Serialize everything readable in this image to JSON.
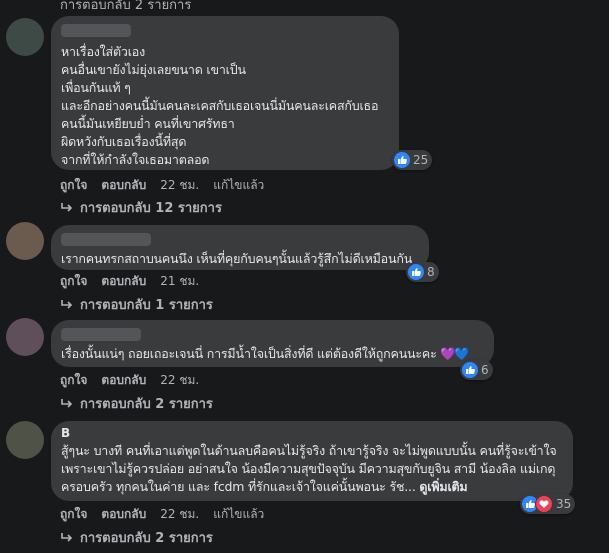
{
  "top_replies": "การตอบกลับ 2 รายการ",
  "comments": [
    {
      "author": "",
      "text": "หาเรื่องใส่ตัวเอง\nคนอื่นเขายังไม่ยุ่งเลยขนาด เขาเป็น\nเพื่อนกันแท้ ๆ\nและอีกอย่างคนนี้มันคนละเคสกับเธอเจนนี่มันคนละเคสกับเธอ\nคนนี้มันเหยียบย่ำ คนที่เขาศรัทธา\nผิดหวังกับเธอเรื่องนี้ที่สุด\nจากที่ให้กำลังใจเธอมาตลอด",
      "reaction_count": "25",
      "like": "ถูกใจ",
      "reply": "ตอบกลับ",
      "time": "22 ชม.",
      "edited": "แก้ไขแล้ว",
      "replies": "การตอบกลับ 12 รายการ"
    },
    {
      "author": "",
      "text": "เรากคนทรกสถาบนคนนึง เห็นที่คุยกับคนๆนั้นแล้วรู้สึกไม่ดีเหมือนกัน",
      "reaction_count": "8",
      "like": "ถูกใจ",
      "reply": "ตอบกลับ",
      "time": "21 ชม.",
      "replies": "การตอบกลับ 1 รายการ"
    },
    {
      "author": "",
      "text": "เรื่องนั้นแน่ๆ ถอยเถอะเจนนี่ การมีน้ำใจเป็นสิ่งที่ดี แต่ต้องดีให้ถูกคนนะคะ ",
      "emoji": "💜💙",
      "reaction_count": "6",
      "like": "ถูกใจ",
      "reply": "ตอบกลับ",
      "time": "22 ชม.",
      "replies": "การตอบกลับ 2 รายการ"
    },
    {
      "author": "B",
      "text": "สู้ๆนะ บางที คนที่เอาแต่พูดในด้านลบคือคนไม่รู้จริง ถ้าเขารู้จริง จะไม่พูดแบบนั้น คนที่รู้จะเข้าใจ เพราะเขาไม่รู้ควรปล่อย อย่าสนใจ น้องมีความสุขปัจจุบัน มีความสุขกับยูจิน สามี น้องลิล แม่เกดุ ครอบครัว ทุกคนในค่าย และ fcdm ที่รักและเจ้าใจแค่นั้นพอนะ รัช... ",
      "see_more": "ดูเพิ่มเติม",
      "reaction_count": "35",
      "like": "ถูกใจ",
      "reply": "ตอบกลับ",
      "time": "22 ชม.",
      "edited": "แก้ไขแล้ว",
      "replies": "การตอบกลับ 2 รายการ"
    }
  ],
  "colors": {
    "background": "#18191a",
    "bubble": "#3a3b3c",
    "like_blue": "#2d88ff",
    "love_red": "#f33e58"
  },
  "icons": [
    "like-icon",
    "love-icon",
    "reply-arrow-icon"
  ]
}
